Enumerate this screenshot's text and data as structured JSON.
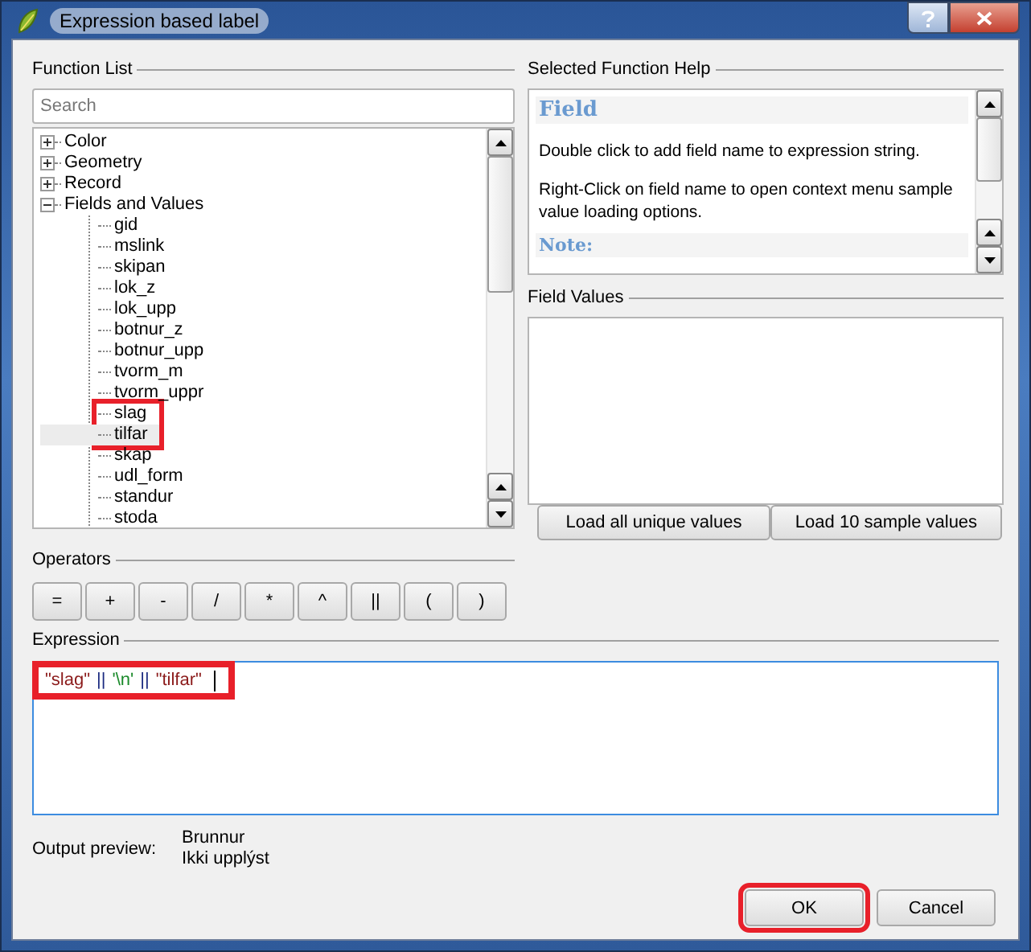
{
  "window": {
    "title": "Expression based label"
  },
  "function_list": {
    "label": "Function List",
    "search": {
      "placeholder": "Search"
    },
    "tree": [
      {
        "label": "Color",
        "expanded": false
      },
      {
        "label": "Geometry",
        "expanded": false
      },
      {
        "label": "Record",
        "expanded": false
      },
      {
        "label": "Fields and Values",
        "expanded": true,
        "children": [
          {
            "label": "gid",
            "selected": false,
            "marked": false
          },
          {
            "label": "mslink",
            "selected": false,
            "marked": false
          },
          {
            "label": "skipan",
            "selected": false,
            "marked": false
          },
          {
            "label": "lok_z",
            "selected": false,
            "marked": false
          },
          {
            "label": "lok_upp",
            "selected": false,
            "marked": false
          },
          {
            "label": "botnur_z",
            "selected": false,
            "marked": false
          },
          {
            "label": "botnur_upp",
            "selected": false,
            "marked": false
          },
          {
            "label": "tvorm_m",
            "selected": false,
            "marked": false
          },
          {
            "label": "tvorm_uppr",
            "selected": false,
            "marked": false
          },
          {
            "label": "slag",
            "selected": false,
            "marked": true
          },
          {
            "label": "tilfar",
            "selected": true,
            "marked": true
          },
          {
            "label": "skap",
            "selected": false,
            "marked": false
          },
          {
            "label": "udl_form",
            "selected": false,
            "marked": false
          },
          {
            "label": "standur",
            "selected": false,
            "marked": false
          },
          {
            "label": "stoda",
            "selected": false,
            "marked": false
          }
        ]
      }
    ]
  },
  "help": {
    "label": "Selected Function Help",
    "title": "Field",
    "paragraphs": [
      "Double click to add field name to expression string.",
      "Right-Click on field name to open context menu sample value loading options."
    ],
    "note": "Note:"
  },
  "field_values": {
    "label": "Field Values",
    "buttons": [
      "Load all unique values",
      "Load 10 sample values"
    ]
  },
  "operators": {
    "label": "Operators",
    "buttons": [
      "=",
      "+",
      "-",
      "/",
      "*",
      "^",
      "||",
      "(",
      ")"
    ]
  },
  "expression": {
    "label": "Expression",
    "marked": true,
    "tokens": [
      {
        "kind": "field",
        "text": "\"slag\""
      },
      {
        "kind": "operator",
        "text": "||"
      },
      {
        "kind": "string",
        "text": "'\\n'"
      },
      {
        "kind": "operator",
        "text": "||"
      },
      {
        "kind": "field",
        "text": "\"tilfar\""
      }
    ]
  },
  "output_preview": {
    "label": "Output preview:",
    "lines": [
      "Brunnur",
      "Ikki upplýst"
    ]
  },
  "buttons": [
    {
      "label": "OK",
      "marked": true
    },
    {
      "label": "Cancel",
      "marked": false
    }
  ]
}
